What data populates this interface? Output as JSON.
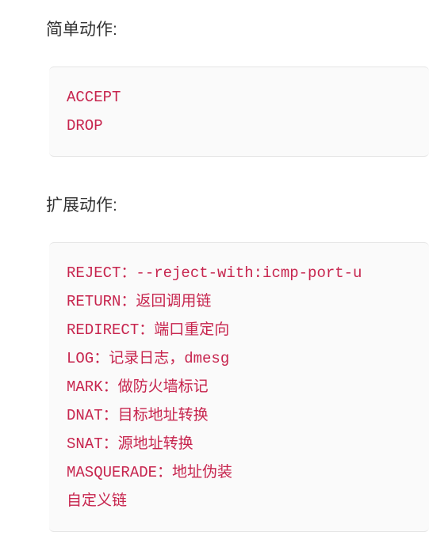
{
  "section1": {
    "heading": "简单动作:",
    "lines": [
      "ACCEPT",
      "DROP"
    ]
  },
  "section2": {
    "heading": "扩展动作:",
    "lines": [
      "REJECT：--reject-with:icmp-port-u",
      "RETURN：返回调用链",
      "REDIRECT：端口重定向",
      "LOG：记录日志，dmesg",
      "MARK：做防火墙标记",
      "DNAT：目标地址转换",
      "SNAT：源地址转换",
      "MASQUERADE：地址伪装",
      "自定义链"
    ]
  }
}
